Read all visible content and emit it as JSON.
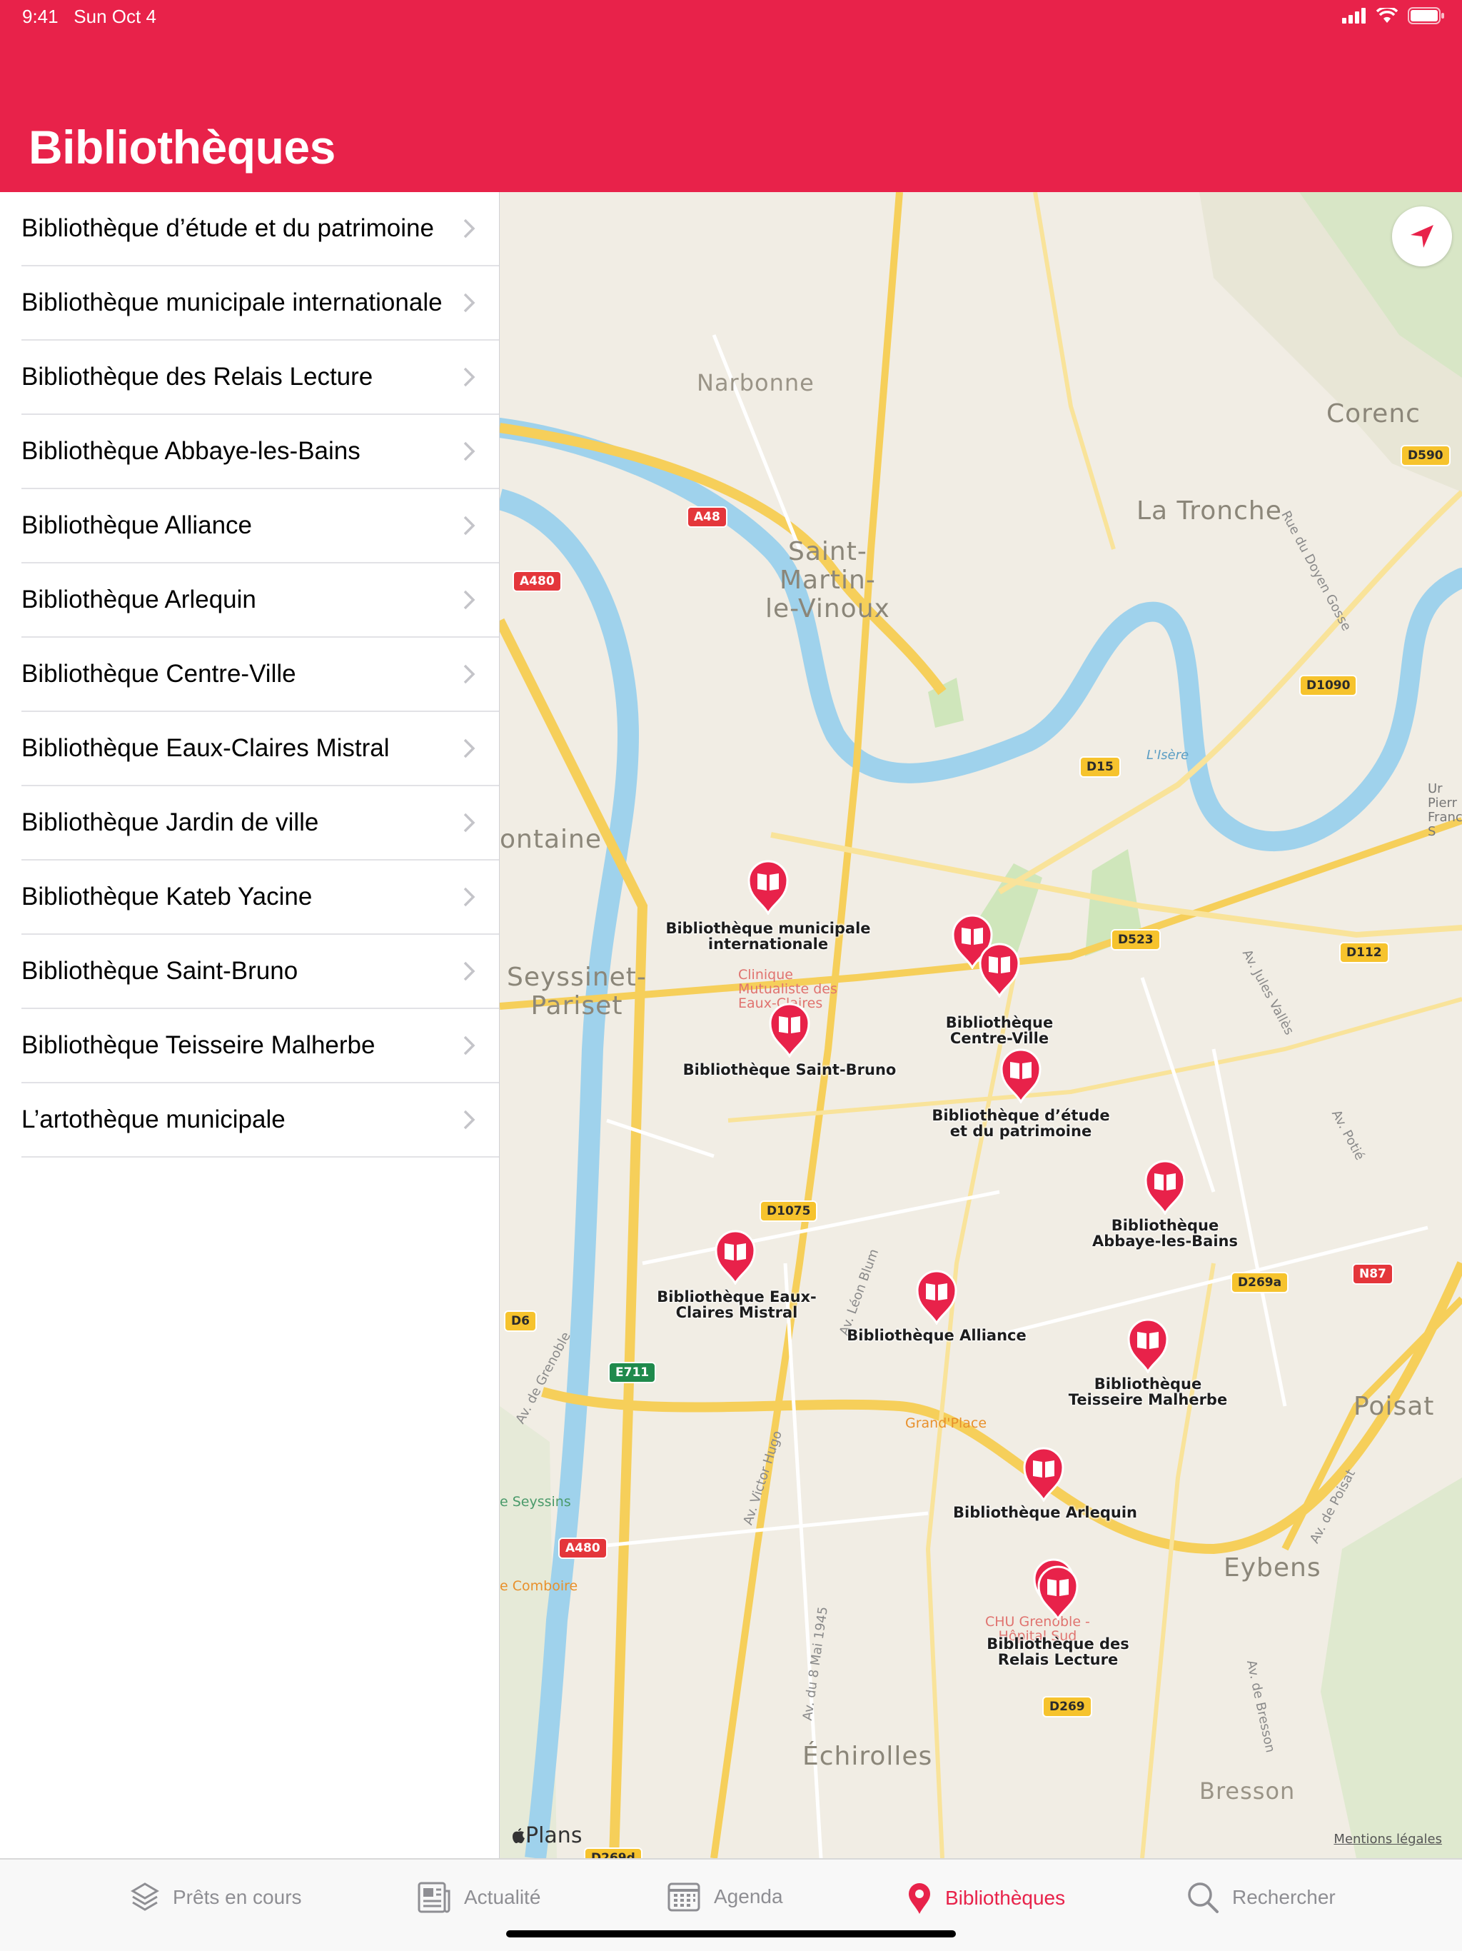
{
  "status": {
    "time": "9:41",
    "date": "Sun Oct 4"
  },
  "colors": {
    "accent": "#e8224a"
  },
  "header": {
    "title": "Bibliothèques"
  },
  "sidebar": {
    "items": [
      {
        "label": "Bibliothèque d’étude et du patrimoine"
      },
      {
        "label": "Bibliothèque municipale internationale"
      },
      {
        "label": "Bibliothèque des Relais Lecture"
      },
      {
        "label": "Bibliothèque Abbaye-les-Bains"
      },
      {
        "label": "Bibliothèque Alliance"
      },
      {
        "label": "Bibliothèque Arlequin"
      },
      {
        "label": "Bibliothèque Centre-Ville"
      },
      {
        "label": "Bibliothèque Eaux-Claires Mistral"
      },
      {
        "label": "Bibliothèque Jardin de ville"
      },
      {
        "label": "Bibliothèque Kateb Yacine"
      },
      {
        "label": "Bibliothèque Saint-Bruno"
      },
      {
        "label": "Bibliothèque Teisseire Malherbe"
      },
      {
        "label": "L’artothèque municipale"
      }
    ]
  },
  "map": {
    "places": {
      "narbonne": "Narbonne",
      "corenc": "Corenc",
      "la_tronche": "La Tronche",
      "saint_martin": "Saint-\nMartin-\nle-Vinoux",
      "fontaine": "ontaine",
      "seyssinet": "Seyssinet-\nPariset",
      "poisat": "Poisat",
      "eybens": "Eybens",
      "echirolles": "Échirolles",
      "bresson": "Bresson",
      "edge_right": "Ur\nPierr\nFranc\nS"
    },
    "roads": {
      "a48": "A48",
      "a480_top": "A480",
      "a480_bottom": "A480",
      "d590": "D590",
      "d1090": "D1090",
      "d15": "D15",
      "d523": "D523",
      "d112": "D112",
      "d1075": "D1075",
      "d269a": "D269a",
      "n87": "N87",
      "d6": "D6",
      "e711": "E711",
      "d269": "D269",
      "d269d": "D269d"
    },
    "streets": {
      "doyen_gosse": "Rue du Doyen Gosse",
      "jules_valles": "Av. Jules Vallès",
      "potie": "Av. Potié",
      "grenoble": "Av. de Grenoble",
      "leon_blum": "Av. Léon Blum",
      "victor_hugo": "Av. Victor Hugo",
      "mai_1945": "Av. du 8 Mai 1945",
      "poisat": "Av. de Poisat",
      "bresson": "Av. de Bresson",
      "isere": "L'Isère"
    },
    "pois": {
      "clinique": "Clinique\nMutualiste des\nEaux-Claires",
      "grand_place": "Grand'Place",
      "chu": "CHU Grenoble -\nHôpital Sud",
      "seyssins": "e Seyssins",
      "comboire": "e Comboire"
    },
    "pins": {
      "internationale": "Bibliothèque municipale\ninternationale",
      "centre_ville": "Bibliothèque\nCentre-Ville",
      "saint_bruno": "Bibliothèque Saint-Bruno",
      "etude": "Bibliothèque d’étude\net du patrimoine",
      "abbaye": "Bibliothèque\nAbbaye-les-Bains",
      "eaux_claires": "Bibliothèque Eaux-\nClaires Mistral",
      "alliance": "Bibliothèque Alliance",
      "teisseire": "Bibliothèque\nTeisseire Malherbe",
      "arlequin": "Bibliothèque Arlequin",
      "relais": "Bibliothèque des\nRelais Lecture"
    },
    "attribution": "Plans",
    "legal": "Mentions légales"
  },
  "tabbar": {
    "tabs": [
      {
        "label": "Prêts en cours",
        "icon": "stack-icon"
      },
      {
        "label": "Actualité",
        "icon": "newspaper-icon"
      },
      {
        "label": "Agenda",
        "icon": "calendar-icon"
      },
      {
        "label": "Bibliothèques",
        "icon": "location-pin-icon"
      },
      {
        "label": "Rechercher",
        "icon": "search-icon"
      }
    ],
    "active_index": 3
  }
}
